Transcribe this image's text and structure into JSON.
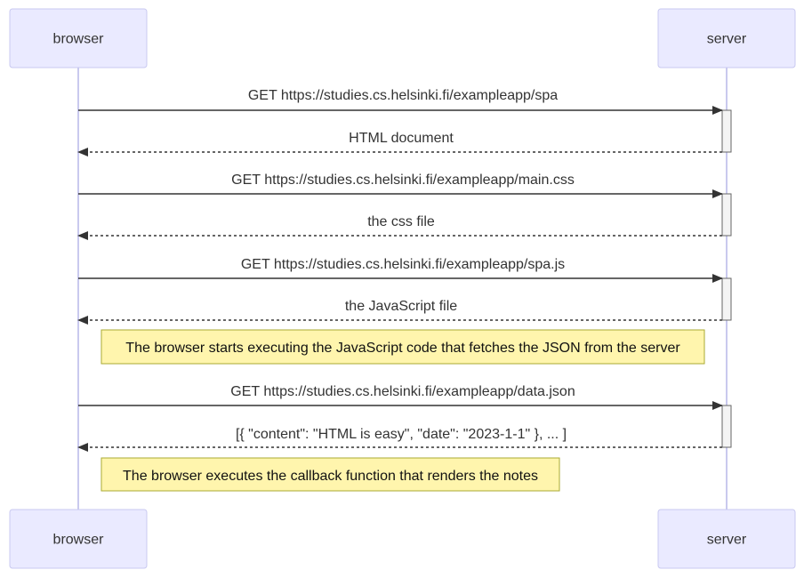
{
  "actors": {
    "browser": "browser",
    "server": "server"
  },
  "messages": [
    {
      "text": "GET https://studies.cs.helsinki.fi/exampleapp/spa",
      "from": "browser",
      "to": "server",
      "style": "solid"
    },
    {
      "text": "HTML document",
      "from": "server",
      "to": "browser",
      "style": "dashed"
    },
    {
      "text": "GET https://studies.cs.helsinki.fi/exampleapp/main.css",
      "from": "browser",
      "to": "server",
      "style": "solid"
    },
    {
      "text": "the css file",
      "from": "server",
      "to": "browser",
      "style": "dashed"
    },
    {
      "text": "GET https://studies.cs.helsinki.fi/exampleapp/spa.js",
      "from": "browser",
      "to": "server",
      "style": "solid"
    },
    {
      "text": "the JavaScript file",
      "from": "server",
      "to": "browser",
      "style": "dashed"
    },
    {
      "text": "GET https://studies.cs.helsinki.fi/exampleapp/data.json",
      "from": "browser",
      "to": "server",
      "style": "solid"
    },
    {
      "text": "[{ \"content\": \"HTML is easy\", \"date\": \"2023-1-1\" }, ... ]",
      "from": "server",
      "to": "browser",
      "style": "dashed"
    }
  ],
  "notes": [
    {
      "text": "The browser starts executing the JavaScript code that fetches the JSON from the server"
    },
    {
      "text": "The browser executes the callback function that renders the notes"
    }
  ],
  "colors": {
    "actor_fill": "#eaeaff",
    "actor_border": "#c8c8f0",
    "lifeline": "#c9c9ee",
    "note_fill": "#fff5ad",
    "note_border": "#aaaa33",
    "line": "#333333"
  }
}
